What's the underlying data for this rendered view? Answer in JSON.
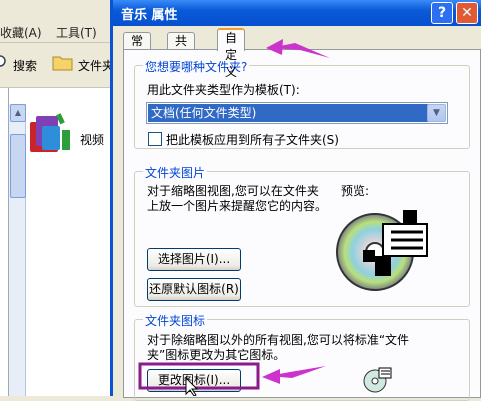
{
  "explorer": {
    "menu": [
      "收藏(A)",
      "工具(T)"
    ],
    "toolbar": {
      "search_label": "搜索",
      "folders_label": "文件夹"
    },
    "item_label": "视频"
  },
  "dialog": {
    "title": "音乐 属性",
    "help_symbol": "?",
    "close_symbol": "✕",
    "tabs": [
      "常规",
      "共享",
      "自定义"
    ],
    "active_tab": "自定义",
    "group_folder_type": {
      "title": "您想要哪种文件夹?",
      "template_label": "用此文件夹类型作为模板(T):",
      "template_value": "文档(任何文件类型)",
      "apply_sub_label": "把此模板应用到所有子文件夹(S)",
      "apply_sub_checked": false
    },
    "group_folder_picture": {
      "title": "文件夹图片",
      "desc_line1": "对于缩略图视图,您可以在文件夹",
      "desc_line2": "上放一个图片来提醒您它的内容。",
      "preview_label": "预览:",
      "choose_button": "选择图片(I)...",
      "restore_button": "还原默认图标(R)"
    },
    "group_folder_icon": {
      "title": "文件夹图标",
      "desc_line1": "对于除缩略图以外的所有视图,您可以将标准“文件",
      "desc_line2": "夹”图标更改为其它图标。",
      "change_button": "更改图标(I)..."
    }
  },
  "annotations": {
    "arrow_color": "#cc33cc",
    "highlight_color": "#8b1a8b"
  }
}
